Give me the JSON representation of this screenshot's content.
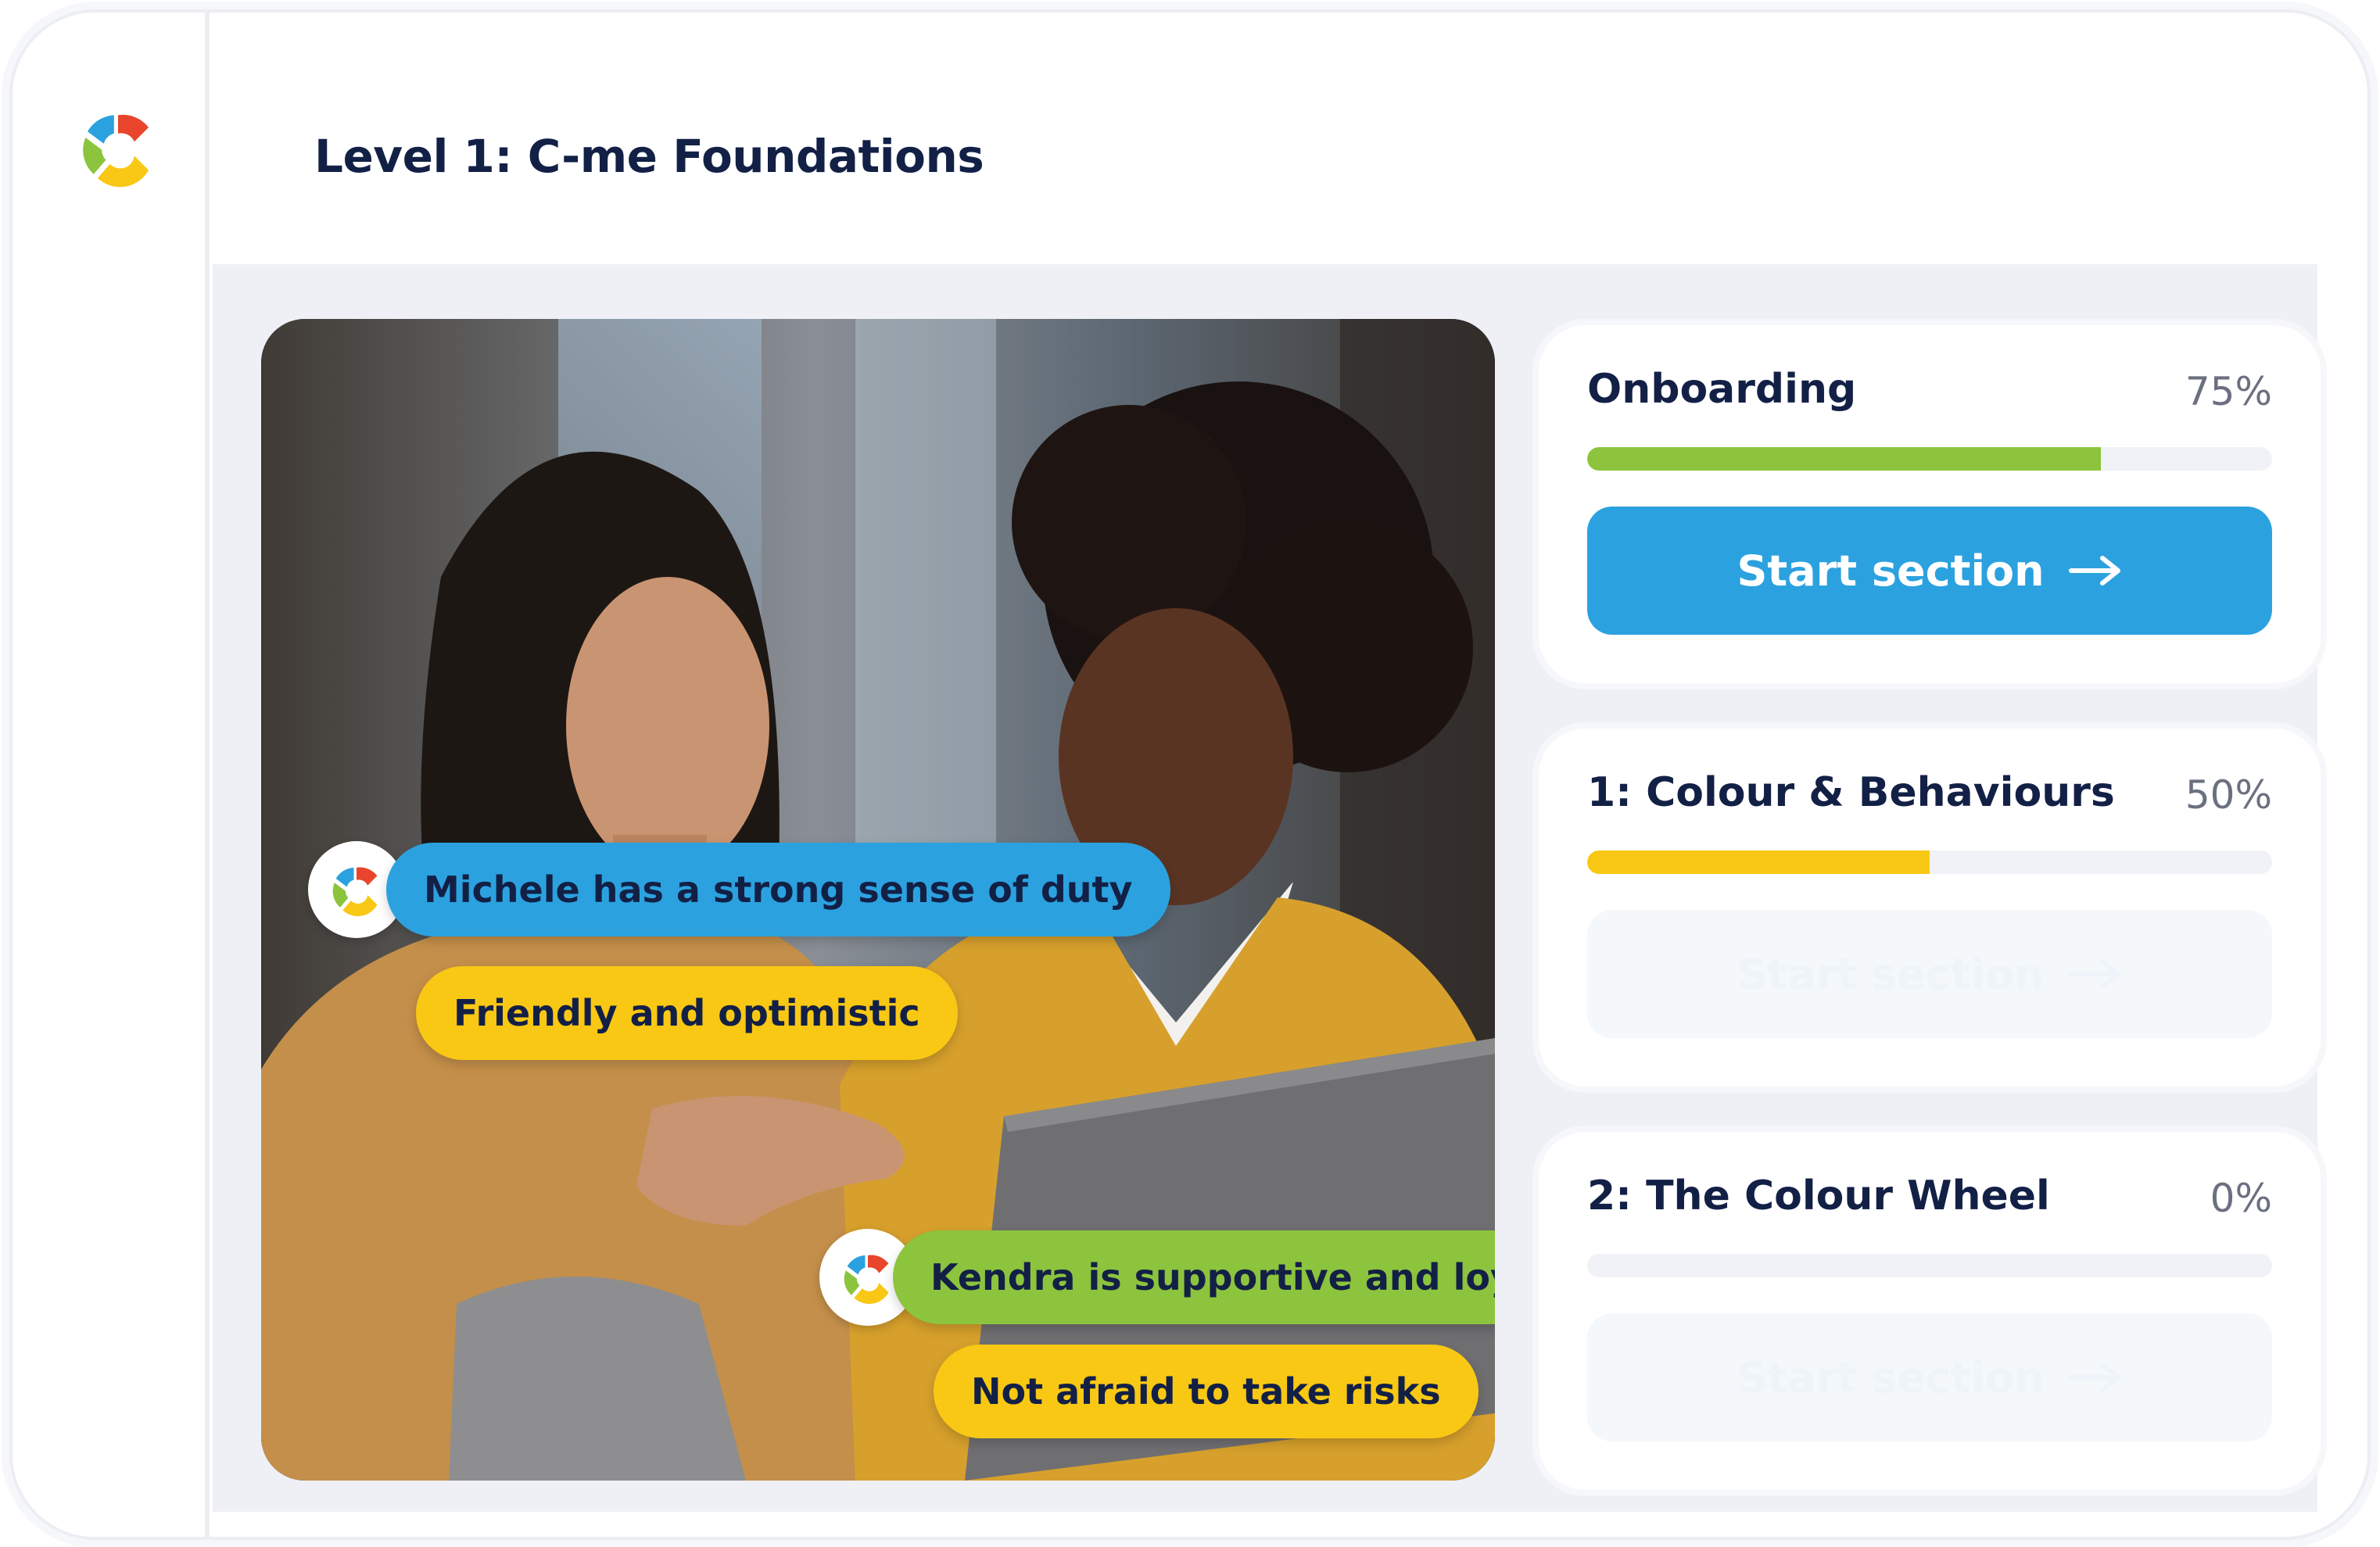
{
  "header": {
    "title": "Level 1: C-me Foundations"
  },
  "hero": {
    "bubbles": [
      {
        "text": "Michele has a strong sense of duty"
      },
      {
        "text": "Friendly and optimistic"
      },
      {
        "text": "Kendra is supportive and loyal"
      },
      {
        "text": "Not afraid to take risks"
      }
    ]
  },
  "sections": [
    {
      "title": "Onboarding",
      "progress_label": "75%",
      "progress": 0.75,
      "button_label": "Start section",
      "enabled": true,
      "bar_color": "#8cc43d"
    },
    {
      "title": "1: Colour & Behaviours",
      "progress_label": "50%",
      "progress": 0.5,
      "button_label": "Start section",
      "enabled": false,
      "bar_color": "#f9c814"
    },
    {
      "title": "2: The Colour Wheel",
      "progress_label": "0%",
      "progress": 0,
      "button_label": "Start section",
      "enabled": false,
      "bar_color": "#2ba2df"
    }
  ],
  "colors": {
    "blue": "#2ba2df",
    "yellow": "#f9c814",
    "green": "#8cc43d",
    "red": "#e8452c",
    "navy": "#132046"
  },
  "icons": [
    "c-me-logo",
    "arrow-right-icon"
  ]
}
